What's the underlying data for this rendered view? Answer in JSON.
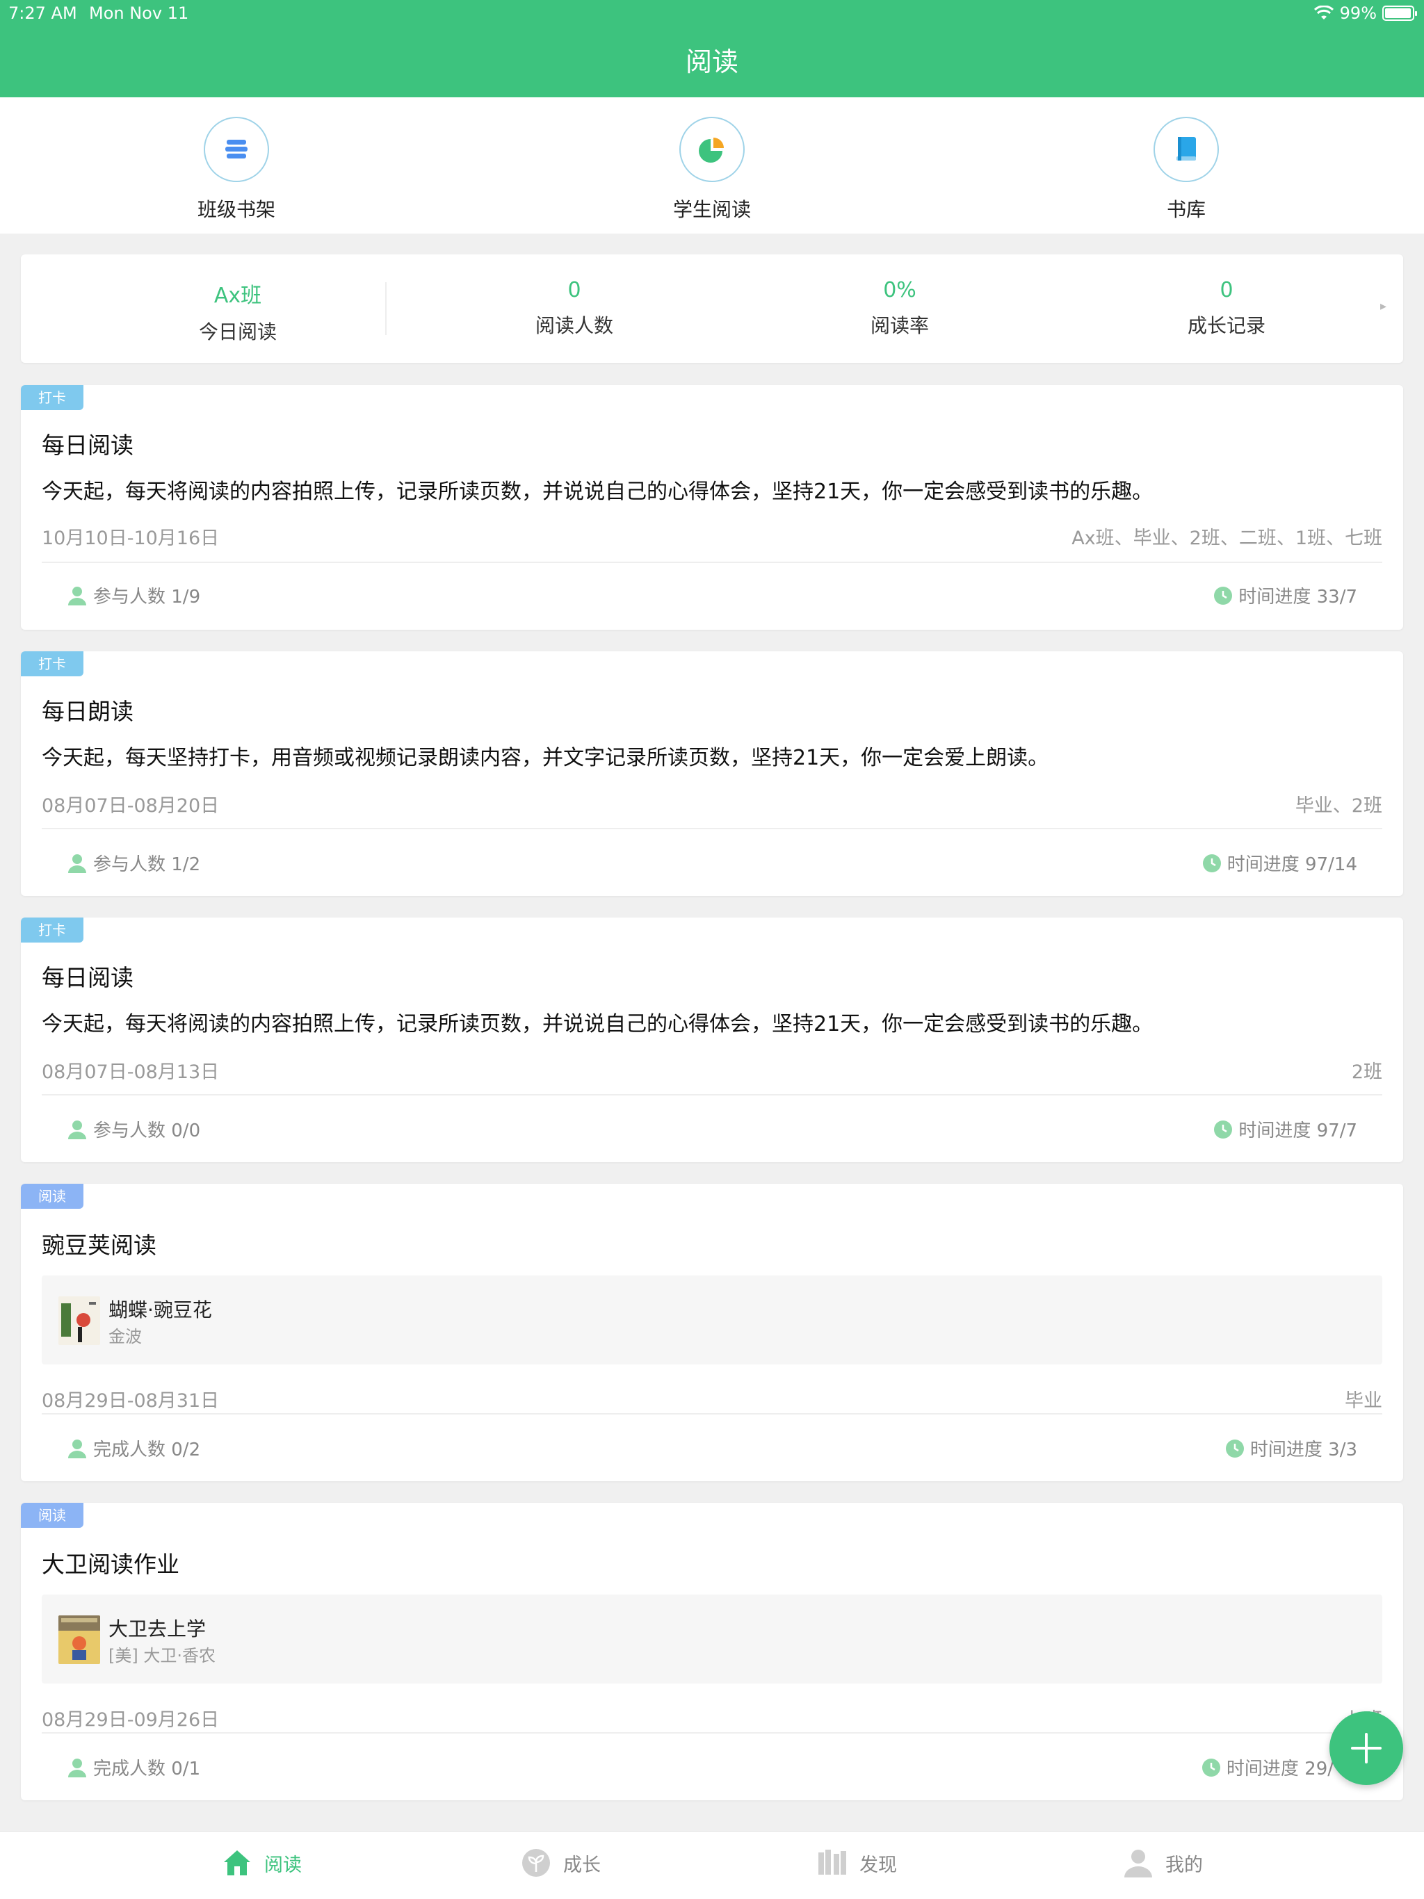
{
  "status": {
    "time": "7:27 AM",
    "date": "Mon Nov 11",
    "battery": "99%"
  },
  "nav": {
    "title": "阅读"
  },
  "quick_actions": [
    {
      "label": "班级书架",
      "icon": "bookshelf-icon"
    },
    {
      "label": "学生阅读",
      "icon": "pie-chart-icon"
    },
    {
      "label": "书库",
      "icon": "book-icon"
    }
  ],
  "stats": {
    "class_name": "Ax班",
    "class_label": "今日阅读",
    "items": [
      {
        "value": "0",
        "label": "阅读人数"
      },
      {
        "value": "0%",
        "label": "阅读率"
      },
      {
        "value": "0",
        "label": "成长记录"
      }
    ]
  },
  "tasks": [
    {
      "tag": "打卡",
      "title": "每日阅读",
      "desc": "今天起，每天将阅读的内容拍照上传，记录所读页数，并说说自己的心得体会，坚持21天，你一定会感受到读书的乐趣。",
      "date": "10月10日-10月16日",
      "classes": "Ax班、毕业、2班、二班、1班、七班",
      "participants": "参与人数 1/9",
      "progress": "时间进度 33/7"
    },
    {
      "tag": "打卡",
      "title": "每日朗读",
      "desc": "今天起，每天坚持打卡，用音频或视频记录朗读内容，并文字记录所读页数，坚持21天，你一定会爱上朗读。",
      "date": "08月07日-08月20日",
      "classes": "毕业、2班",
      "participants": "参与人数 1/2",
      "progress": "时间进度 97/14"
    },
    {
      "tag": "打卡",
      "title": "每日阅读",
      "desc": "今天起，每天将阅读的内容拍照上传，记录所读页数，并说说自己的心得体会，坚持21天，你一定会感受到读书的乐趣。",
      "date": "08月07日-08月13日",
      "classes": "2班",
      "participants": "参与人数 0/0",
      "progress": "时间进度 97/7"
    },
    {
      "tag": "阅读",
      "title": "豌豆荚阅读",
      "book_name": "蝴蝶·豌豆花",
      "book_author": "金波",
      "date": "08月29日-08月31日",
      "classes": "毕业",
      "participants": "完成人数 0/2",
      "progress": "时间进度 3/3"
    },
    {
      "tag": "阅读",
      "title": "大卫阅读作业",
      "book_name": "大卫去上学",
      "book_author": "[美] 大卫·香农",
      "date": "08月29日-09月26日",
      "classes": "七班",
      "participants": "完成人数 0/1",
      "progress": "时间进度 29/"
    }
  ],
  "tabbar": [
    {
      "label": "阅读",
      "icon": "home-icon",
      "active": true
    },
    {
      "label": "成长",
      "icon": "sprout-icon",
      "active": false
    },
    {
      "label": "发现",
      "icon": "books-icon",
      "active": false
    },
    {
      "label": "我的",
      "icon": "person-icon",
      "active": false
    }
  ],
  "colors": {
    "brand": "#3dc37e",
    "tag_checkin": "#7fc9ee",
    "tag_read": "#8cb4f5"
  }
}
